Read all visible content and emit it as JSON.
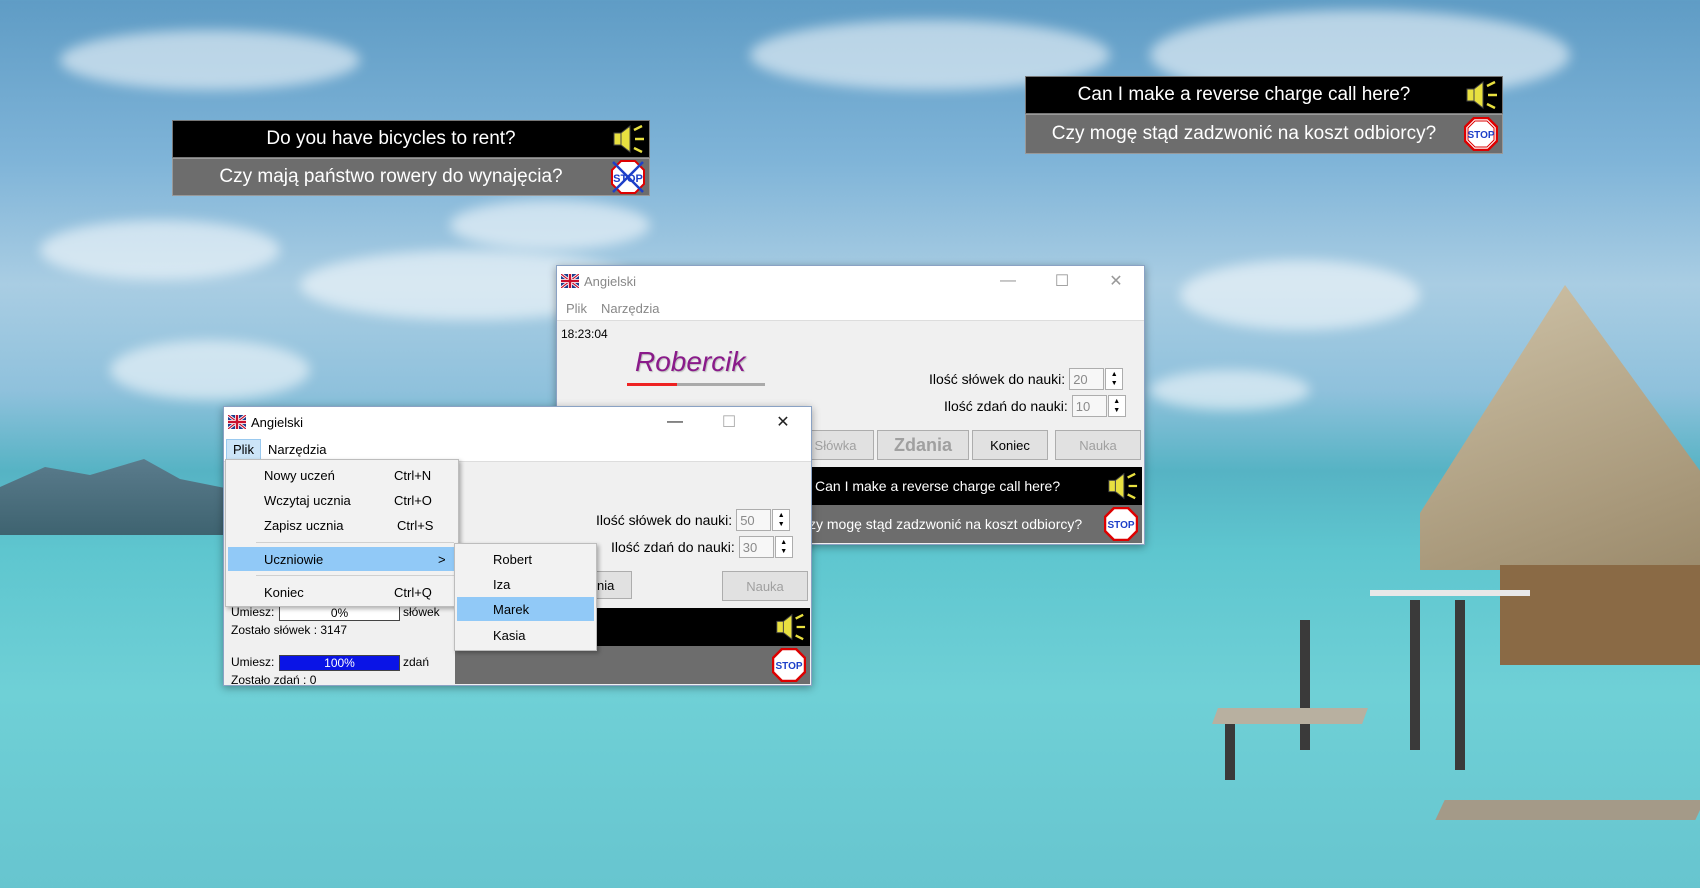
{
  "subtitle_boxes": [
    {
      "english": "Do you have bicycles to rent?",
      "polish": "Czy mają państwo rowery do wynajęcia?"
    },
    {
      "english": "Can I make a reverse charge call here?",
      "polish": "Czy mogę stąd zadzwonić na koszt odbiorcy?"
    }
  ],
  "window_back": {
    "title": "Angielski",
    "menu": [
      "Plik",
      "Narzędzia"
    ],
    "clock": "18:23:04",
    "student_name": "Robercik",
    "words_label": "Ilość słówek do nauki:",
    "words_value": "20",
    "sentences_label": "Ilość zdań do nauki:",
    "sentences_value": "10",
    "buttons": {
      "words": "Słówka",
      "sentences": "Zdania",
      "end": "Koniec",
      "learn": "Nauka"
    },
    "english": "Can I make a reverse charge call here?",
    "polish": "zy mogę stąd zadzwonić na koszt odbiorcy?"
  },
  "window_front": {
    "title": "Angielski",
    "menu": [
      "Plik",
      "Narzędzia"
    ],
    "words_label": "Ilość słówek do nauki:",
    "words_value": "50",
    "sentences_label": "Ilość zdań do nauki:",
    "sentences_value": "30",
    "partial_button": "nia",
    "learn_button": "Nauka",
    "stats": {
      "knows_label": "Umiesz:",
      "words_percent_text": "0%",
      "words_percent": 0,
      "words_unit": "słówek",
      "words_left": "Zostało słówek : 3147",
      "sentences_percent_text": "100%",
      "sentences_percent": 100,
      "sentences_unit": "zdań",
      "sentences_left": "Zostało zdań : 0"
    }
  },
  "file_menu": {
    "items": [
      {
        "label": "Nowy uczeń",
        "shortcut": "Ctrl+N"
      },
      {
        "label": "Wczytaj ucznia",
        "shortcut": "Ctrl+O"
      },
      {
        "label": "Zapisz ucznia",
        "shortcut": "Ctrl+S"
      }
    ],
    "students_label": "Uczniowie",
    "students_arrow": ">",
    "end": {
      "label": "Koniec",
      "shortcut": "Ctrl+Q"
    }
  },
  "students_submenu": {
    "items": [
      "Robert",
      "Iza",
      "Marek",
      "Kasia"
    ],
    "selected": "Marek"
  },
  "icons": {
    "speaker": "speaker-icon",
    "stop": "stop-sign-icon",
    "flag": "uk-flag-icon"
  },
  "stop_text": "STOP"
}
